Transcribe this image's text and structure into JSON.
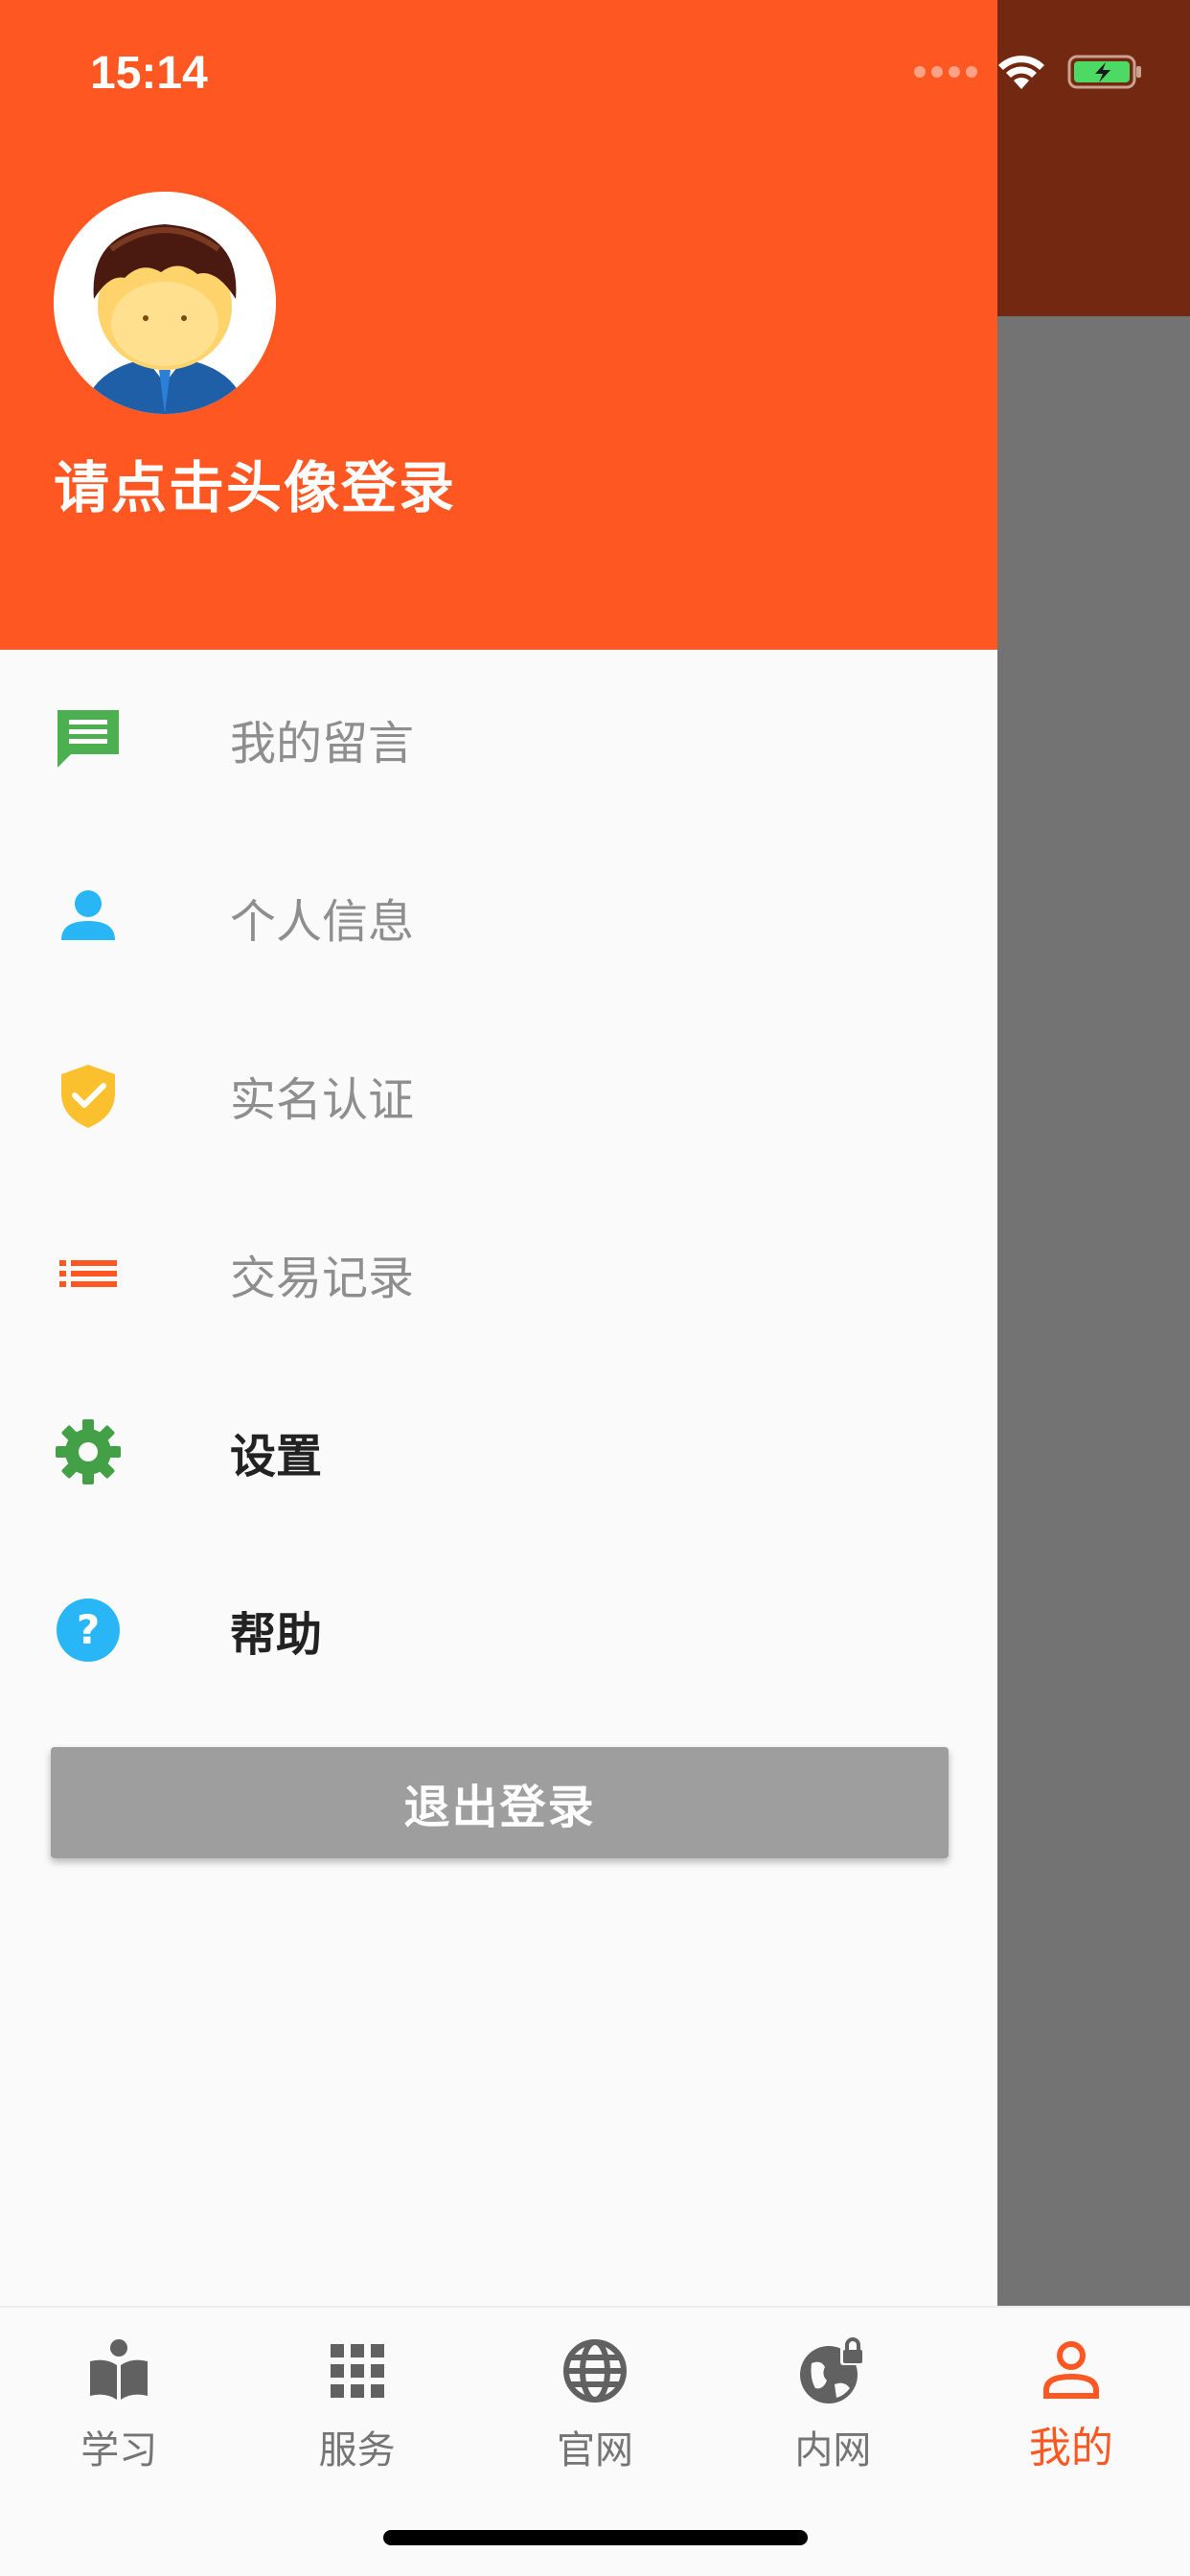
{
  "status_bar": {
    "time": "15:14"
  },
  "drawer": {
    "login_hint": "请点击头像登录",
    "menu": [
      {
        "label": "我的留言",
        "icon": "message-icon",
        "color": "#4caf50"
      },
      {
        "label": "个人信息",
        "icon": "person-icon",
        "color": "#29b6f6"
      },
      {
        "label": "实名认证",
        "icon": "verified-shield-icon",
        "color": "#fbc02d"
      },
      {
        "label": "交易记录",
        "icon": "list-icon",
        "color": "#ff5722"
      },
      {
        "label": "设置",
        "icon": "gear-icon",
        "color": "#43a047"
      },
      {
        "label": "帮助",
        "icon": "help-icon",
        "color": "#29b6f6"
      }
    ],
    "logout_label": "退出登录"
  },
  "tabbar": {
    "tabs": [
      {
        "label": "学习",
        "icon": "book-icon"
      },
      {
        "label": "服务",
        "icon": "apps-grid-icon"
      },
      {
        "label": "官网",
        "icon": "globe-icon"
      },
      {
        "label": "内网",
        "icon": "globe-lock-icon"
      },
      {
        "label": "我的",
        "icon": "user-icon",
        "active": true
      }
    ]
  },
  "colors": {
    "accent": "#ff5722",
    "drawer_bg": "#fafafa",
    "scrim": "#737373",
    "button_grey": "#9e9e9e"
  }
}
